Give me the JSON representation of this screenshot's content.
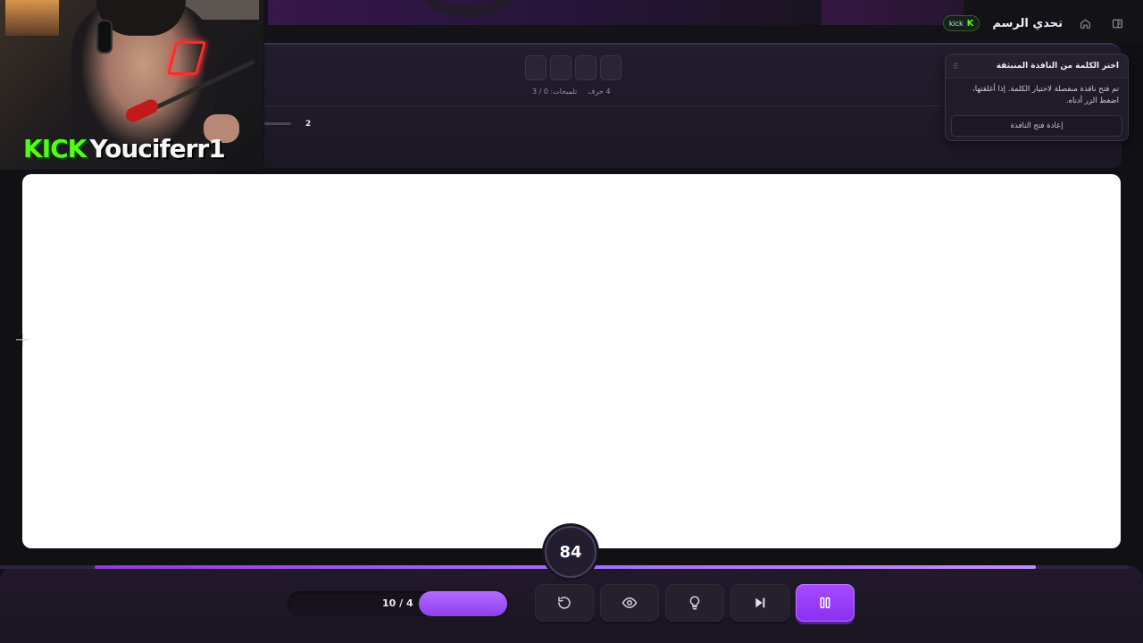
{
  "header": {
    "title": "تحدي الرسم",
    "kick_badge": "kick",
    "kick_logo": "K",
    "home_icon": "home-icon",
    "sidebar_icon": "sidebar-toggle-icon"
  },
  "word_panel": {
    "letter_count": 4,
    "letters_label": "4 حرف",
    "hints_label": "تلميحات: 0 / 3",
    "round_number": "2"
  },
  "popup": {
    "title": "اختر الكلمة من النافذة المنبثقة",
    "body": "تم فتح نافذة منفصلة لاختيار الكلمة. إذا أغلقتها، اضغط الزر أدناه.",
    "button": "إعادة فتح النافذة",
    "drag_icon": "⠿"
  },
  "webcam": {
    "platform": "KICK",
    "streamer": "Youciferr1"
  },
  "timer": {
    "seconds": "84",
    "progress_fraction": 0.91
  },
  "controls": {
    "rounds_label": "10 / 4",
    "rounds_fraction": 0.4,
    "buttons": [
      {
        "name": "restart-icon",
        "primary": false
      },
      {
        "name": "eye-icon",
        "primary": false
      },
      {
        "name": "lightbulb-icon",
        "primary": false
      },
      {
        "name": "skip-icon",
        "primary": false
      },
      {
        "name": "pause-icon",
        "primary": true
      }
    ]
  },
  "colors": {
    "accent": "#9b44ff",
    "kick_green": "#53fc18",
    "background": "#111015"
  }
}
